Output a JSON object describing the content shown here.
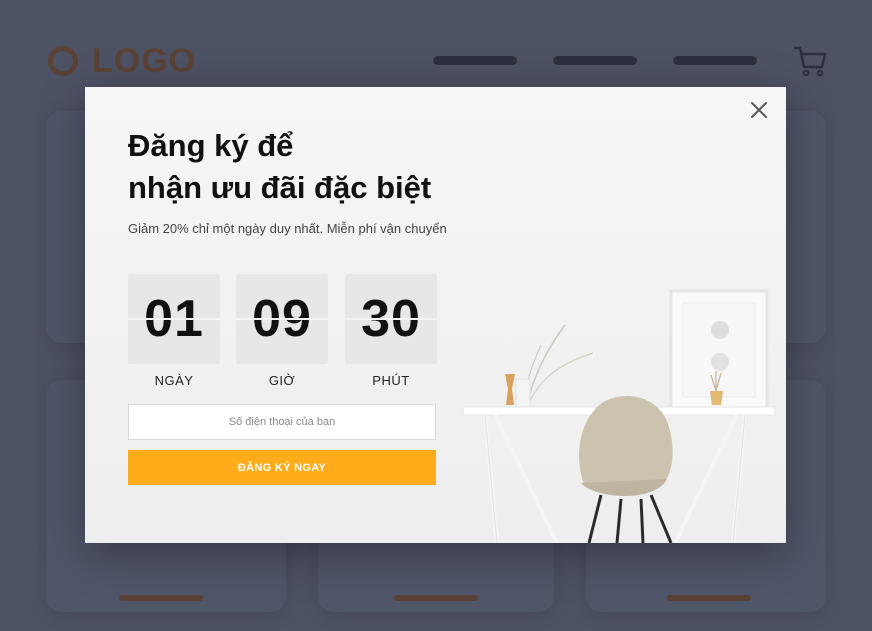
{
  "site": {
    "logo_text": "LOGO"
  },
  "popup": {
    "title_line1": "Đăng ký để",
    "title_line2": "nhận ưu đãi đặc biệt",
    "subtitle": "Giảm 20% chỉ một ngày duy nhất. Miễn phí vận chuyển",
    "countdown": [
      {
        "value": "01",
        "label": "NGÀY"
      },
      {
        "value": "09",
        "label": "GIỜ"
      },
      {
        "value": "30",
        "label": "PHÚT"
      }
    ],
    "phone_placeholder": "Số điện thoại của bạn",
    "submit_label": "ĐĂNG KÝ NGAY"
  },
  "colors": {
    "accent": "#ffac1a",
    "overlay": "#4d5265",
    "logo": "#5a4236"
  },
  "icons": {
    "close": "close-icon",
    "cart": "cart-icon"
  }
}
